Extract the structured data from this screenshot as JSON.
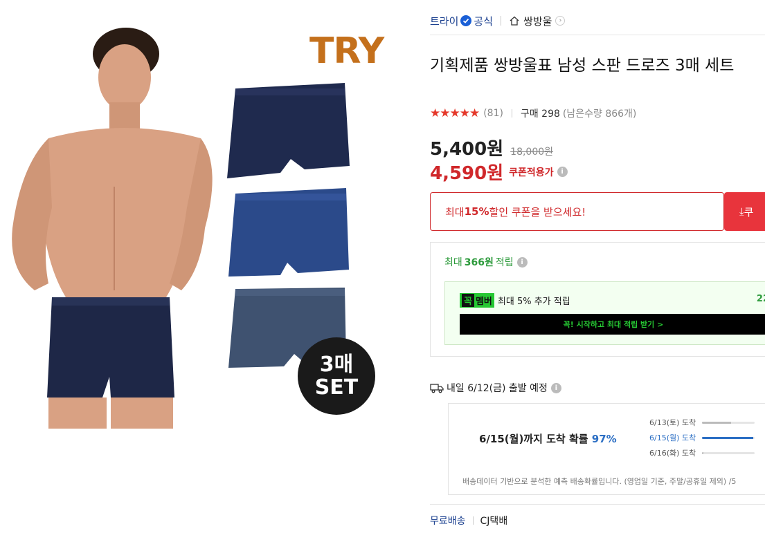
{
  "image": {
    "brand_logo": "TRY",
    "set_badge_line1": "3매",
    "set_badge_line2": "SET"
  },
  "header": {
    "brand": "트라이",
    "official": "공식",
    "store": "쌍방울",
    "icons": [
      "verified-badge-icon",
      "home-icon",
      "chevron-right-icon"
    ]
  },
  "product": {
    "title": "기획제품 쌍방울표 남성 스판 드로즈 3매 세트",
    "rating": 4.5,
    "rating_count": "(81)",
    "purchase": "구매 298",
    "remaining": "(남은수량 866개)"
  },
  "price": {
    "current": "5,400원",
    "original": "18,000원",
    "coupon_price": "4,590원",
    "coupon_label": "쿠폰적용가"
  },
  "coupon": {
    "prefix": "최대 ",
    "percent": "15%",
    "suffix": " 할인 쿠폰을 받으세요!",
    "button": "쿠"
  },
  "points": {
    "prefix": "최대",
    "amount": "366원",
    "suffix": "적립",
    "member_badge_1": "꼭",
    "member_badge_2": "멤버",
    "member_text": "최대 5% 추가 적립",
    "member_right": "22",
    "member_cta": "꼭! 시작하고 최대 적립 받기 >"
  },
  "shipping": {
    "departure": "내일 6/12(금) 출발 예정",
    "arrival_main_prefix": "6/15(월)까지 도착 확률 ",
    "arrival_pct": "97%",
    "arrival_items": [
      {
        "label": "6/13(토) 도착",
        "value": 0.55,
        "active": false
      },
      {
        "label": "6/15(월) 도착",
        "value": 0.97,
        "active": true
      },
      {
        "label": "6/16(화) 도착",
        "value": 0.02,
        "active": false
      }
    ],
    "note": "배송데이터 기반으로 분석한 예측 배송확률입니다. (영업일 기준, 주말/공휴일 제외) /5"
  },
  "delivery": {
    "free": "무료배송",
    "carrier": "CJ택배"
  },
  "colors": {
    "accent_red": "#d0282b",
    "accent_blue": "#1a3f8f",
    "green": "#2c9a3b"
  }
}
